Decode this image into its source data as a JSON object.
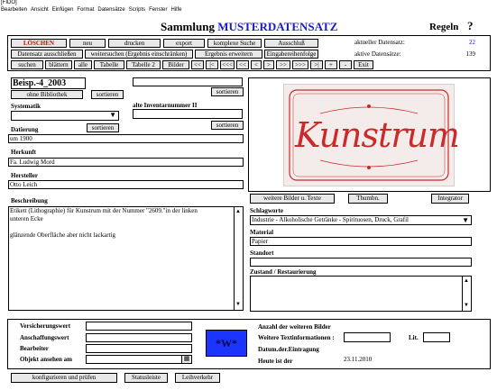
{
  "window": {
    "title": "[FIDO]"
  },
  "menu": [
    "Bearbeiten",
    "Ansicht",
    "Einfügen",
    "Format",
    "Datensätze",
    "Scripts",
    "Fenster",
    "Hilfe"
  ],
  "header": {
    "title_prefix": "Sammlung",
    "title_highlight": "MUSTERDATENSATZ",
    "regeln": "Regeln",
    "help": "?"
  },
  "toolbar": {
    "row1": [
      "LÖSCHEN",
      "neu",
      "drucken",
      "export",
      "komplexe Suche",
      "Ausschluß"
    ],
    "row2": [
      "Datensatz ausschließen",
      "weitersuchen (Ergebnis einschränken)",
      "Ergebnis erweitern",
      "Eingabereihenfolge"
    ],
    "row3": [
      "suchen",
      "blättern",
      "alle",
      "Tabelle",
      "Tabelle 2",
      "Bilder",
      "<<",
      "|<",
      "<<<",
      "<<",
      "<",
      ">",
      ">>",
      ">>>",
      ">|",
      "+",
      "-",
      "Exit"
    ],
    "current_label": "aktueller Datensatz:",
    "current_value": "22",
    "active_label": "aktive Datensätze:",
    "active_value": "139"
  },
  "form": {
    "id_value": "Beisp.-4_2003",
    "ohne_bibliothek": "ohne Bibliothek",
    "sortieren": "sortieren",
    "systematik_label": "Systematik",
    "alte_inv_label": "alte Inventarnummer II",
    "datierung_label": "Datierung",
    "datierung_value": "um 1900",
    "herkunft_label": "Herkunft",
    "herkunft_value": "Fa. Ludwig Mord",
    "hersteller_label": "Hersteller",
    "hersteller_value": "Otto Leich",
    "beschreibung_label": "Beschreibung",
    "beschreibung_line1": "Etikett (Lithographie) für Kunstrum mit der Nummer \"2609.\"in der linken",
    "beschreibung_line2": "unteren Ecke",
    "beschreibung_line3": "glänzende Oberfläche aber nicht lackartig"
  },
  "image": {
    "label_text": "Kunstrum",
    "weitere_bilder": "weitere Bilder u. Texte",
    "thumbn": "Thumbn.",
    "integrator": "Integrator"
  },
  "right": {
    "schlagworte_label": "Schlagworte",
    "schlagworte_value": "Industrie - Alkoholische Getränke - Spirituosen, Druck, Grafil",
    "material_label": "Material",
    "material_value": "Papier",
    "standort_label": "Standort",
    "zustand_label": "Zustand / Restaurierung"
  },
  "bottom": {
    "versicherungswert": "Versicherungswert",
    "anschaffungswert": "Anschaffungswert",
    "bearbeiter": "Bearbeiter",
    "objekt_ansehen": "Objekt ansehen am",
    "badge": "*W*",
    "anzahl_bilder": "Anzahl der weiteren Bilder",
    "weitere_text": "Weitere Textinformationen :",
    "lit": "Lit.",
    "datum_eintragung": "Datum.der.Eintragung",
    "heute_label": "Heute ist der",
    "heute_value": "23.11.2010"
  },
  "footer": [
    "konfigurieren und prüfen",
    "Statusleiste",
    "Leihverkehr"
  ],
  "colors": {
    "accent_blue": "#1a1ad0",
    "delete_red": "#e00000",
    "badge_blue": "#1b35ff",
    "label_red": "#cc2a2a"
  }
}
